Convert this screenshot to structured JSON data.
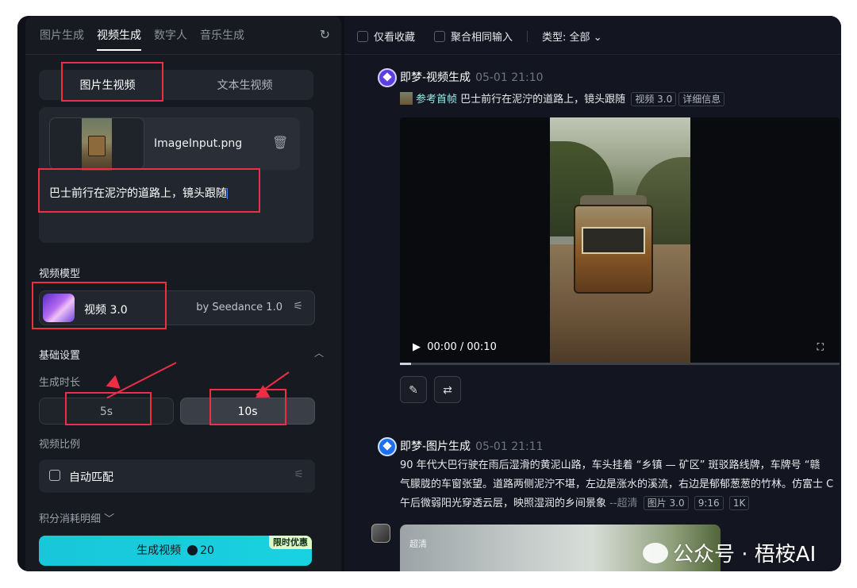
{
  "left": {
    "tabs": [
      "图片生成",
      "视频生成",
      "数字人",
      "音乐生成"
    ],
    "active_tab": "视频生成",
    "mode_tabs": {
      "image_to_video": "图片生视频",
      "text_to_video": "文本生视频"
    },
    "upload": {
      "filename": "ImageInput.png",
      "prompt": "巴士前行在泥泞的道路上，镜头跟随"
    },
    "model_section": "视频模型",
    "model": {
      "name": "视频 3.0",
      "by": "by Seedance 1.0"
    },
    "basic_settings": "基础设置",
    "duration_label": "生成时长",
    "durations": [
      "5s",
      "10s"
    ],
    "ratio_label": "视频比例",
    "ratio_value": "自动匹配",
    "points_label": "积分消耗明细",
    "generate": {
      "label": "生成视频",
      "cost": "20",
      "promo": "限时优惠"
    }
  },
  "right": {
    "filters": {
      "fav": "仅看收藏",
      "merge": "聚合相同输入",
      "type": "类型: 全部"
    },
    "item1": {
      "title": "即梦-视频生成",
      "time": "05-01  21:10",
      "ref": "参考首帧",
      "prompt": "巴士前行在泥泞的道路上，镜头跟随",
      "tag_model": "视频 3.0",
      "tag_detail": "详细信息",
      "player_time": "00:00 / 00:10"
    },
    "item2": {
      "title": "即梦-图片生成",
      "time": "05-01  21:11",
      "line1": "90 年代大巴行驶在雨后湿滑的黄泥山路，车头挂着 “乡镇 — 矿区” 斑驳路线牌，车牌号 “赣",
      "line2": "气朦胧的车窗张望。道路两侧泥泞不堪，左边是涨水的溪流，右边是郁郁葱葱的竹林。仿富士 C",
      "line3": "午后微弱阳光穿透云层，映照湿润的乡间景象",
      "quality": "--超清",
      "tags": [
        "图片 3.0",
        "9:16",
        "1K"
      ],
      "preview_label": "超清"
    },
    "watermark": "公众号 · 梧桉AI"
  },
  "colors": {
    "accent": "#18c7d9",
    "annotation": "#ee2e44",
    "panel": "#171a21"
  }
}
